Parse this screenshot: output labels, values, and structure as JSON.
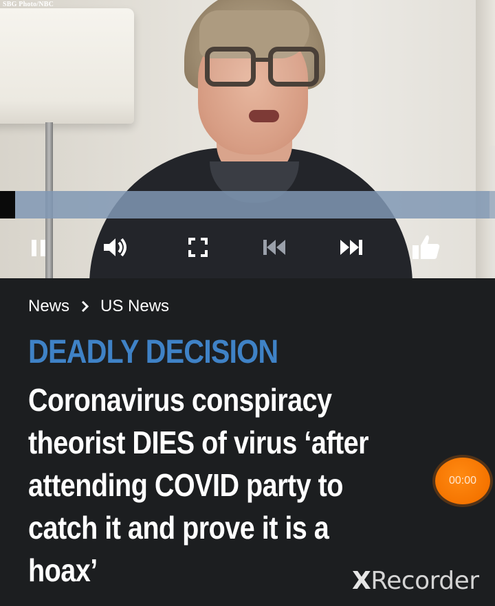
{
  "video": {
    "credit": "SBG Photo/NBC",
    "progress_fraction": 0.03,
    "controls": {
      "pause_icon": "pause-icon",
      "volume_icon": "volume-icon",
      "fullscreen_icon": "fullscreen-icon",
      "previous_icon": "skip-back-icon",
      "next_icon": "skip-forward-icon",
      "like_icon": "thumbs-up-icon"
    },
    "colors": {
      "progress_bar": "#8098b4",
      "progress_played": "#0a0a0a"
    }
  },
  "article": {
    "breadcrumb": [
      "News",
      "US News"
    ],
    "kicker": "DEADLY DECISION",
    "headline_lines": [
      "Coronavirus conspiracy",
      "theorist DIES of virus ‘after",
      "attending COVID party to",
      "catch it and prove it is a",
      "hoax’"
    ],
    "colors": {
      "background": "#1c1e20",
      "kicker": "#3f82c6",
      "headline": "#ffffff"
    }
  },
  "recorder": {
    "timer": "00:00",
    "watermark_x": "X",
    "watermark_text": "Recorder",
    "colors": {
      "timer": "#f57400"
    }
  }
}
